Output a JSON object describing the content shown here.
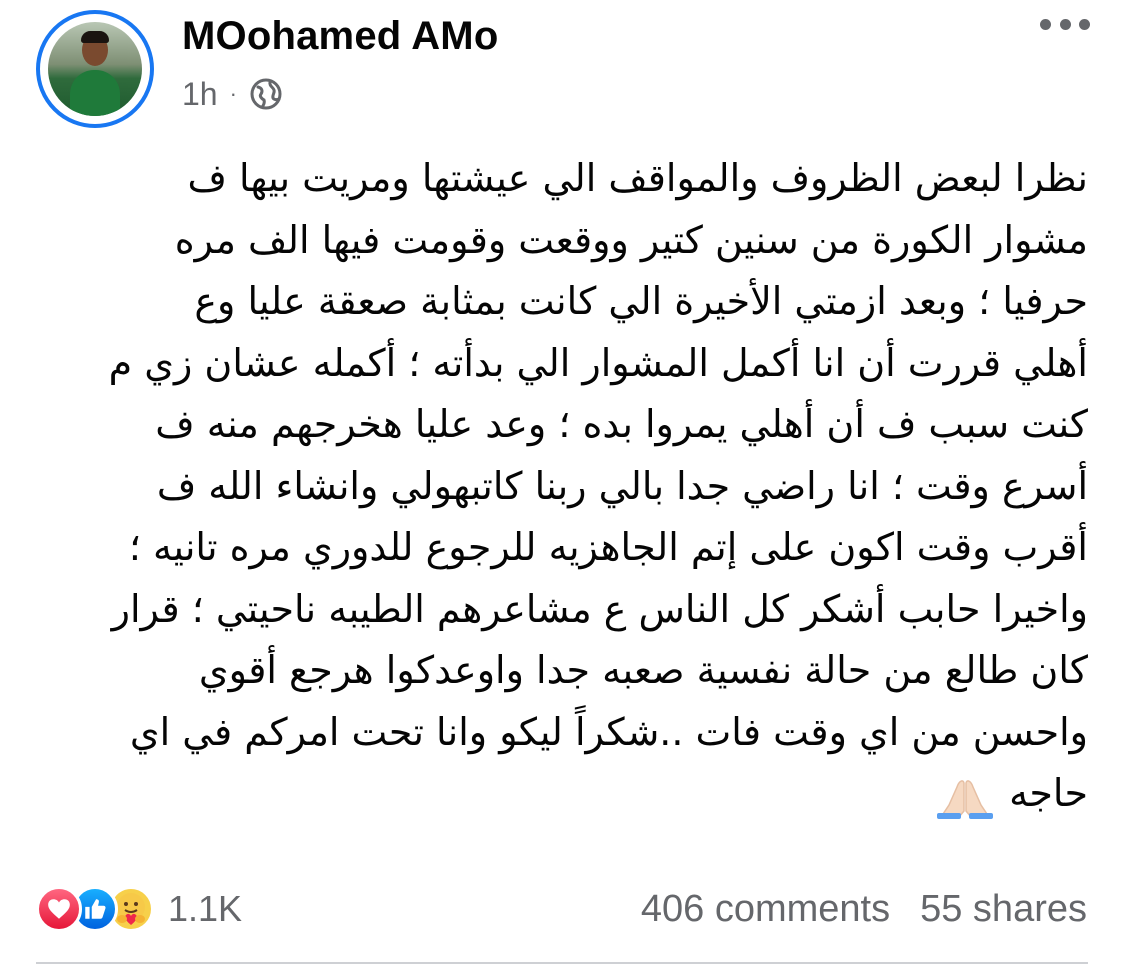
{
  "post": {
    "author_name": "MOohamed AMo",
    "time": "1h",
    "separator": "·",
    "audience_icon": "globe-icon",
    "more_icon": "more-options-icon",
    "text_lines": [
      "نظرا لبعض الظروف والمواقف الي عيشتها ومريت بيها ف",
      "مشوار الكورة من سنين كتير ووقعت وقومت فيها الف مره",
      "حرفيا ؛ وبعد ازمتي الأخيرة الي كانت بمثابة صعقة عليا وع",
      "أهلي قررت أن انا أكمل المشوار الي بدأته ؛ أكمله عشان زي م",
      "كنت سبب ف أن أهلي يمروا بده ؛ وعد عليا هخرجهم منه ف",
      "أسرع وقت ؛ انا راضي جدا بالي ربنا كاتبهولي وانشاء الله ف",
      "أقرب وقت اكون على إتم الجاهزيه للرجوع للدوري مره تانيه ؛",
      "واخيرا حابب أشكر كل الناس ع مشاعرهم الطيبه ناحيتي ؛ قرار",
      "كان طالع من حالة نفسية صعبه جدا واوعدكوا هرجع أقوي",
      "واحسن من اي وقت فات ..شكراً ليكو وانا تحت امركم في اي",
      "حاجه"
    ],
    "emoji": "folded-hands-icon"
  },
  "footer": {
    "reactions": [
      "love-reaction-icon",
      "like-reaction-icon",
      "care-reaction-icon"
    ],
    "reaction_count": "1.1K",
    "comments": "406 comments",
    "shares": "55 shares"
  },
  "colors": {
    "accent": "#1877f2",
    "secondary_text": "#65676b",
    "primary_text": "#050505"
  }
}
